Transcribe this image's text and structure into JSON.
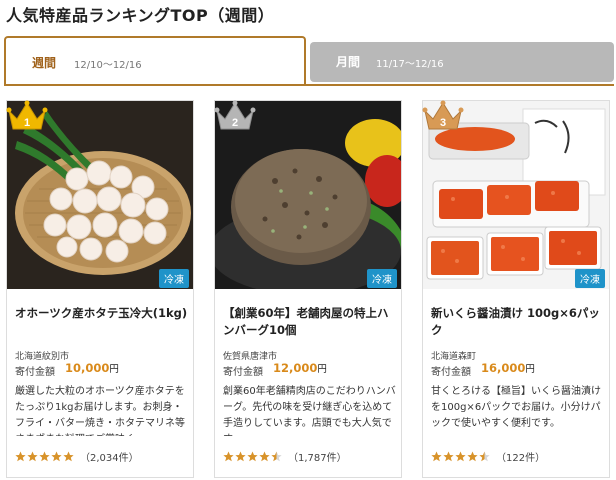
{
  "page": {
    "title": "人気特産品ランキングTOP（週間）"
  },
  "tabs": [
    {
      "label": "週間",
      "range": "12/10〜12/16",
      "active": true
    },
    {
      "label": "月間",
      "range": "11/17〜12/16",
      "active": false
    }
  ],
  "colors": {
    "accent": "#b07a2a",
    "price": "#d98a1b",
    "frozen_badge": "#1f93c9",
    "star": "#d8932a",
    "gold": "#f0b800",
    "silver": "#b5b5b5",
    "bronze": "#d89a55"
  },
  "cards": [
    {
      "rank": "1",
      "crown": "gold",
      "badge": "冷凍",
      "name": "オホーツク産ホタテ玉冷大(1kg)",
      "region": "北海道紋別市",
      "amount_label": "寄付金額",
      "amount": "10,000",
      "yen": "円",
      "desc": "厳選した大粒のオホーツク産ホタテをたっぷり1kgお届けします。お刺身・フライ・バター焼き・ホタテマリネ等さまざまな料理でご賞味く…",
      "rating": 5,
      "count": "（2,034件）"
    },
    {
      "rank": "2",
      "crown": "silver",
      "badge": "冷凍",
      "name": "【創業60年】老舗肉屋の特上ハンバーグ10個",
      "region": "佐賀県唐津市",
      "amount_label": "寄付金額",
      "amount": "12,000",
      "yen": "円",
      "desc": "創業60年老舗精肉店のこだわりハンバーグ。先代の味を受け継ぎ心を込めて手造りしています。店頭でも大人気です。",
      "rating": 4.5,
      "count": "（1,787件）"
    },
    {
      "rank": "3",
      "crown": "bronze",
      "badge": "冷凍",
      "name": "新いくら醤油漬け 100g×6パック",
      "region": "北海道森町",
      "amount_label": "寄付金額",
      "amount": "16,000",
      "yen": "円",
      "desc": "甘くとろける【極旨】いくら醤油漬けを100g×6パックでお届け。小分けパックで使いやすく便利です。",
      "rating": 4.5,
      "count": "（122件）"
    }
  ]
}
